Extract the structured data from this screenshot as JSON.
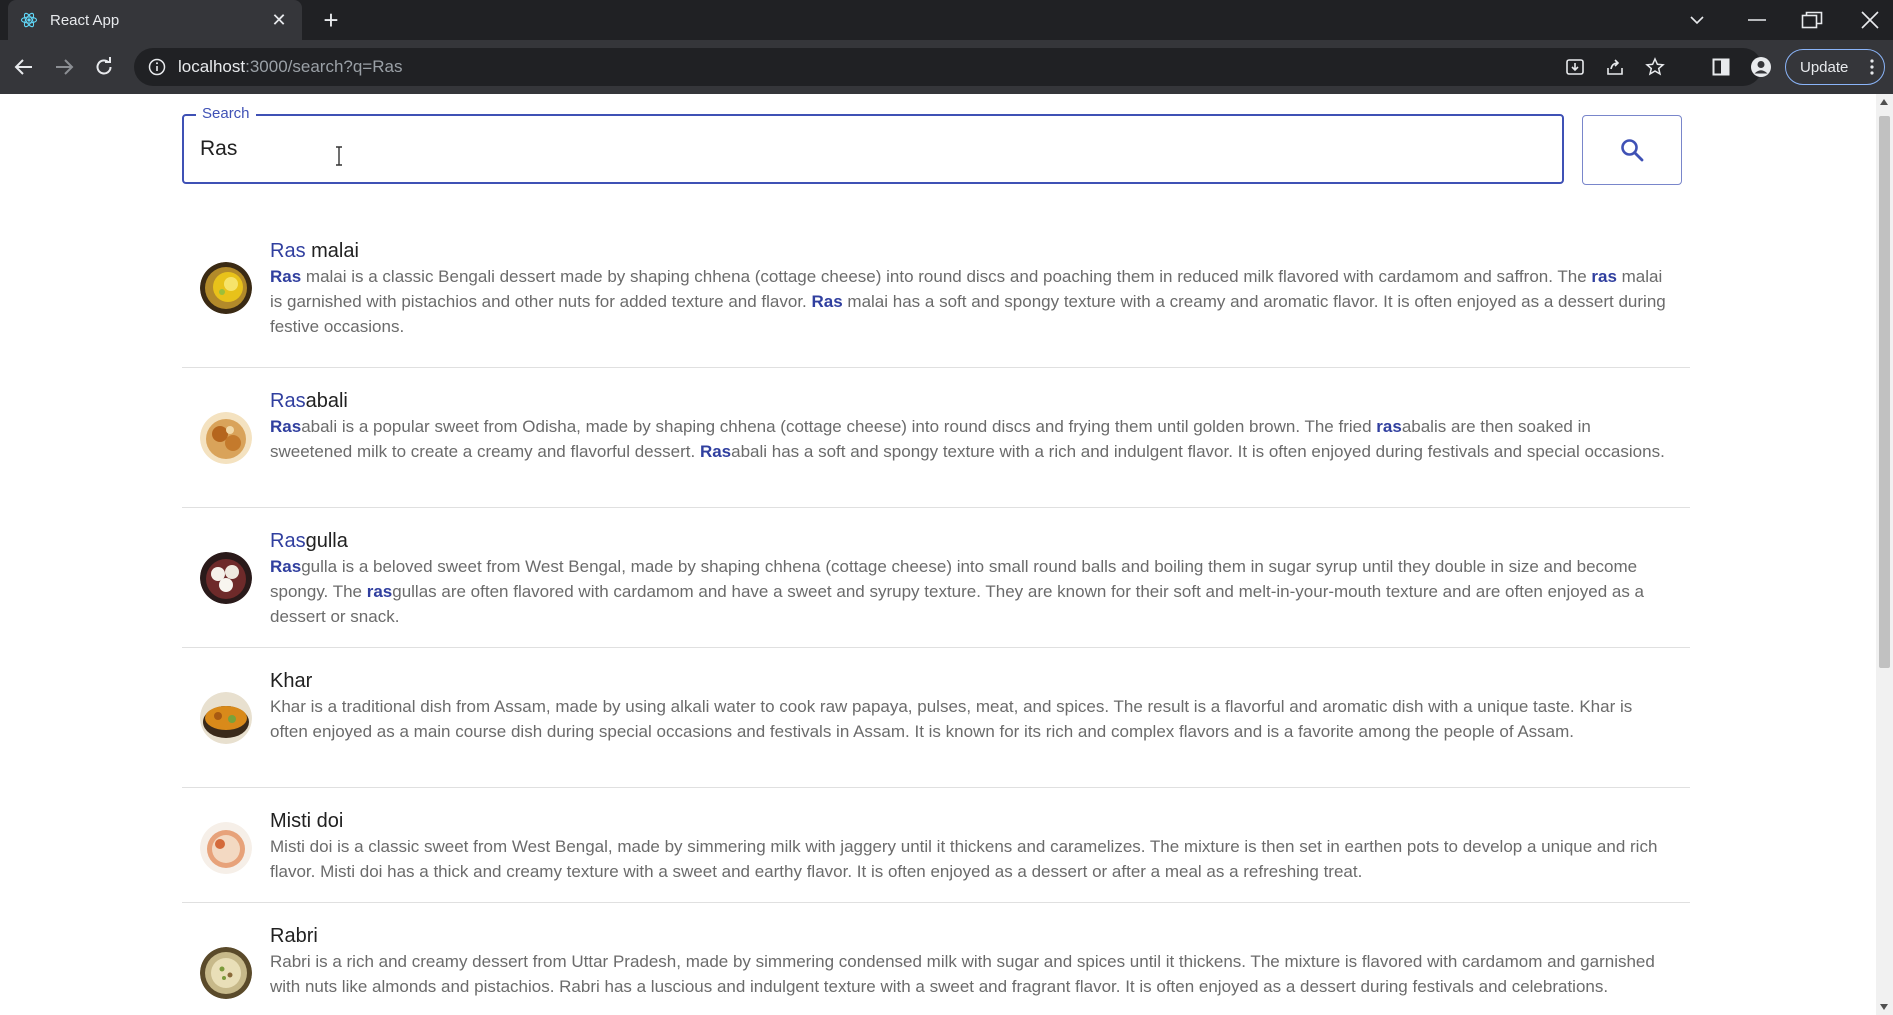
{
  "browser": {
    "tab_title": "React App",
    "url_host": "localhost",
    "url_path": ":3000/search?q=Ras",
    "update_label": "Update",
    "colors": {
      "frame": "#202124",
      "toolbar": "#35363a",
      "accent": "#8ab4f8"
    }
  },
  "search": {
    "label": "Search",
    "value": "Ras",
    "button_icon": "search-icon",
    "accent_color": "#3f51b5"
  },
  "results": [
    {
      "title_match": "Ras",
      "title_rest": " malai",
      "icon": "ras-malai-image",
      "desc": [
        {
          "t": "Ras",
          "h": true
        },
        {
          "t": " malai is a classic Bengali dessert made by shaping chhena (cottage cheese) into round discs and poaching them in reduced milk flavored with cardamom and saffron. The ",
          "h": false
        },
        {
          "t": "ras",
          "h": true
        },
        {
          "t": " malai is garnished with pistachios and other nuts for added texture and flavor. ",
          "h": false
        },
        {
          "t": "Ras",
          "h": true
        },
        {
          "t": " malai has a soft and spongy texture with a creamy and aromatic flavor. It is often enjoyed as a dessert during festive occasions.",
          "h": false
        }
      ]
    },
    {
      "title_match": "Ras",
      "title_rest": "abali",
      "icon": "rasabali-image",
      "desc": [
        {
          "t": "Ras",
          "h": true
        },
        {
          "t": "abali is a popular sweet from Odisha, made by shaping chhena (cottage cheese) into round discs and frying them until golden brown. The fried ",
          "h": false
        },
        {
          "t": "ras",
          "h": true
        },
        {
          "t": "abalis are then soaked in sweetened milk to create a creamy and flavorful dessert. ",
          "h": false
        },
        {
          "t": "Ras",
          "h": true
        },
        {
          "t": "abali has a soft and spongy texture with a rich and indulgent flavor. It is often enjoyed during festivals and special occasions.",
          "h": false
        }
      ]
    },
    {
      "title_match": "Ras",
      "title_rest": "gulla",
      "icon": "rasgulla-image",
      "desc": [
        {
          "t": "Ras",
          "h": true
        },
        {
          "t": "gulla is a beloved sweet from West Bengal, made by shaping chhena (cottage cheese) into small round balls and boiling them in sugar syrup until they double in size and become spongy. The ",
          "h": false
        },
        {
          "t": "ras",
          "h": true
        },
        {
          "t": "gullas are often flavored with cardamom and have a sweet and syrupy texture. They are known for their soft and melt-in-your-mouth texture and are often enjoyed as a dessert or snack.",
          "h": false
        }
      ]
    },
    {
      "title_match": "",
      "title_rest": "Khar",
      "icon": "khar-image",
      "desc": [
        {
          "t": "Khar is a traditional dish from Assam, made by using alkali water to cook raw papaya, pulses, meat, and spices. The result is a flavorful and aromatic dish with a unique taste. Khar is often enjoyed as a main course dish during special occasions and festivals in Assam. It is known for its rich and complex flavors and is a favorite among the people of Assam.",
          "h": false
        }
      ]
    },
    {
      "title_match": "",
      "title_rest": "Misti doi",
      "icon": "misti-doi-image",
      "desc": [
        {
          "t": "Misti doi is a classic sweet from West Bengal, made by simmering milk with jaggery until it thickens and caramelizes. The mixture is then set in earthen pots to develop a unique and rich flavor. Misti doi has a thick and creamy texture with a sweet and earthy flavor. It is often enjoyed as a dessert or after a meal as a refreshing treat.",
          "h": false
        }
      ]
    },
    {
      "title_match": "",
      "title_rest": "Rabri",
      "icon": "rabri-image",
      "desc": [
        {
          "t": "Rabri is a rich and creamy dessert from Uttar Pradesh, made by simmering condensed milk with sugar and spices until it thickens. The mixture is flavored with cardamom and garnished with nuts like almonds and pistachios. Rabri has a luscious and indulgent texture with a sweet and fragrant flavor. It is often enjoyed as a dessert during festivals and celebrations.",
          "h": false
        }
      ]
    }
  ]
}
